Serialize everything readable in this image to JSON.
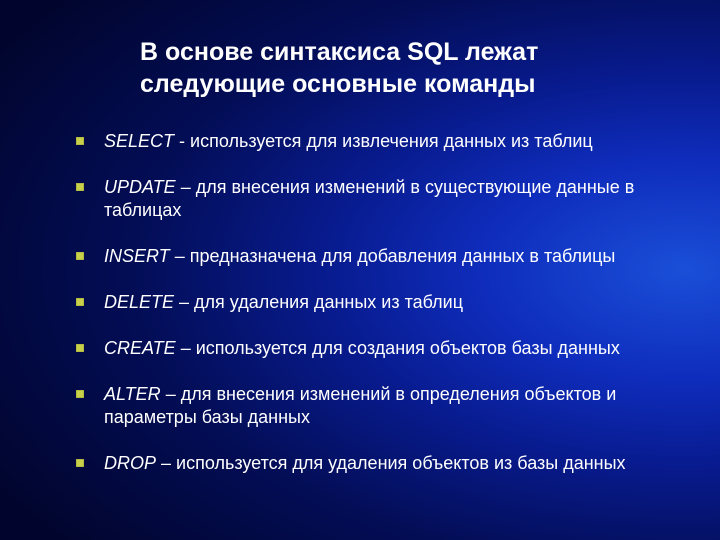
{
  "title_line1": "В основе синтаксиса SQL лежат",
  "title_line2": "следующие основные команды",
  "items": [
    {
      "cmd": "SELECT",
      "sep": " - ",
      "desc": "используется для извлечения данных из таблиц",
      "cont": ""
    },
    {
      "cmd": "UPDATE",
      "sep": " – ",
      "desc": "для внесения изменений в существующие данные в",
      "cont": "таблицах"
    },
    {
      "cmd": "INSERT",
      "sep": " – ",
      "desc": "предназначена для добавления данных в таблицы",
      "cont": ""
    },
    {
      "cmd": "DELETE",
      "sep": " – ",
      "desc": "для удаления данных из таблиц",
      "cont": ""
    },
    {
      "cmd": "CREATE",
      "sep": " – ",
      "desc": "используется для создания объектов базы данных",
      "cont": ""
    },
    {
      "cmd": "ALTER",
      "sep": " – ",
      "desc": "для внесения изменений в определения объектов и",
      "cont": "параметры базы данных"
    },
    {
      "cmd": "DROP",
      "sep": " – ",
      "desc": "используется для удаления объектов из базы данных",
      "cont": ""
    }
  ]
}
